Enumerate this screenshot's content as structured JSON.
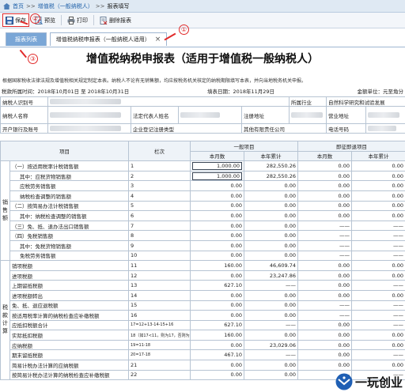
{
  "breadcrumb": {
    "home": "首页",
    "sep1": ">>",
    "item1": "增值税（一般纳税人）",
    "sep2": ">>",
    "item2": "报表填写"
  },
  "toolbar": {
    "save": "保存",
    "preview": "预览",
    "print": "打印",
    "delete": "删除报表"
  },
  "tabs": {
    "list": "报表列表",
    "form": "增值税纳税申报表（一般纳税人适用）",
    "close": "×"
  },
  "annotations": [
    "①",
    "②",
    "③"
  ],
  "form": {
    "title": "增值税纳税申报表（适用于增值税一般纳税人）",
    "note": "根据国家税收法律法规及增值税相关规定制定本表。纳税人不论有无销售额，均应按税务机关核定的纳税期限填写本表，并向当地税务机关申报。",
    "period_label": "税款所属时间：2018年10月01日 至 2018年10月31日",
    "fill_date_label": "填表日期：2018年11月29日",
    "unit_label": "金额单位：元至角分",
    "taxpayer_id_label": "纳税人识别号",
    "industry_label": "所属行业",
    "industry_value": "自然科学研究和试验发展",
    "taxpayer_name_label": "纳税人名称",
    "legal_rep_label": "法定代表人姓名",
    "reg_addr_label": "注册地址",
    "biz_addr_label": "营业地址",
    "bank_label": "开户银行及账号",
    "reg_type_label": "企业登记注册类型",
    "reg_type_value": "其他有限责任公司",
    "phone_label": "电话号码"
  },
  "table": {
    "headers": {
      "item": "项目",
      "col": "栏次",
      "general": "一般项目",
      "refund": "即征即退项目",
      "month": "本月数",
      "year": "本年累计"
    },
    "group_sales": "销售额",
    "group_tax": "税款计算",
    "rows": [
      {
        "label": "（一）按适用税率计税销售额",
        "col": "1",
        "v1": "1,000.00",
        "v2": "282,550.26",
        "v3": "0.00",
        "v4": "0.00"
      },
      {
        "label": "其中：应税货物销售额",
        "col": "2",
        "v1": "1,000.00",
        "v2": "282,550.26",
        "v3": "0.00",
        "v4": "0.00"
      },
      {
        "label": "应税劳务销售额",
        "col": "3",
        "v1": "0.00",
        "v2": "0.00",
        "v3": "0.00",
        "v4": "0.00"
      },
      {
        "label": "纳税检查调整的销售额",
        "col": "4",
        "v1": "0.00",
        "v2": "0.00",
        "v3": "0.00",
        "v4": "0.00"
      },
      {
        "label": "（二）按简易办法计税销售额",
        "col": "5",
        "v1": "0.00",
        "v2": "0.00",
        "v3": "0.00",
        "v4": "0.00"
      },
      {
        "label": "其中：纳税检查调整的销售额",
        "col": "6",
        "v1": "0.00",
        "v2": "0.00",
        "v3": "0.00",
        "v4": "0.00"
      },
      {
        "label": "（三）免、抵、退办法出口销售额",
        "col": "7",
        "v1": "0.00",
        "v2": "0.00",
        "v3": "——",
        "v4": "——"
      },
      {
        "label": "（四）免税销售额",
        "col": "8",
        "v1": "0.00",
        "v2": "0.00",
        "v3": "——",
        "v4": "——"
      },
      {
        "label": "其中：免税货物销售额",
        "col": "9",
        "v1": "0.00",
        "v2": "0.00",
        "v3": "——",
        "v4": "——"
      },
      {
        "label": "免税劳务销售额",
        "col": "10",
        "v1": "0.00",
        "v2": "0.00",
        "v3": "——",
        "v4": "——"
      },
      {
        "label": "销项税额",
        "col": "11",
        "v1": "160.00",
        "v2": "46,609.74",
        "v3": "0.00",
        "v4": "0.00"
      },
      {
        "label": "进项税额",
        "col": "12",
        "v1": "0.00",
        "v2": "23,247.86",
        "v3": "0.00",
        "v4": "0.00"
      },
      {
        "label": "上期留抵税额",
        "col": "13",
        "v1": "627.10",
        "v2": "——",
        "v3": "0.00",
        "v4": "——"
      },
      {
        "label": "进项税额转出",
        "col": "14",
        "v1": "0.00",
        "v2": "0.00",
        "v3": "0.00",
        "v4": "0.00"
      },
      {
        "label": "免、抵、退应退税额",
        "col": "15",
        "v1": "0.00",
        "v2": "0.00",
        "v3": "——",
        "v4": "——"
      },
      {
        "label": "按适用税率计算的纳税检查应补缴税额",
        "col": "16",
        "v1": "0.00",
        "v2": "0.00",
        "v3": "——",
        "v4": "——"
      },
      {
        "label": "应抵扣税额合计",
        "col": "17=12+13-14-15+16",
        "v1": "627.10",
        "v2": "——",
        "v3": "0.00",
        "v4": "——"
      },
      {
        "label": "实际抵扣税额",
        "col": "18（如17<11，则为17，否则为11）",
        "v1": "160.00",
        "v2": "0.00",
        "v3": "0.00",
        "v4": "0.00"
      },
      {
        "label": "应纳税额",
        "col": "19=11-18",
        "v1": "0.00",
        "v2": "23,029.06",
        "v3": "0.00",
        "v4": "0.00"
      },
      {
        "label": "期末留抵税额",
        "col": "20=17-18",
        "v1": "467.10",
        "v2": "——",
        "v3": "0.00",
        "v4": "——"
      },
      {
        "label": "简易计税办法计算的应纳税额",
        "col": "21",
        "v1": "0.00",
        "v2": "0.00",
        "v3": "0.00",
        "v4": "0.00"
      },
      {
        "label": "按简易计税办法计算的纳税检查应补缴税额",
        "col": "22",
        "v1": "0.00",
        "v2": "0.00",
        "v3": "——",
        "v4": "——"
      }
    ]
  },
  "watermark": {
    "text": "一玩创业"
  },
  "colors": {
    "accent": "#e12a2a",
    "tab_active": "#7aa6d6",
    "link": "#1d5fa8"
  }
}
